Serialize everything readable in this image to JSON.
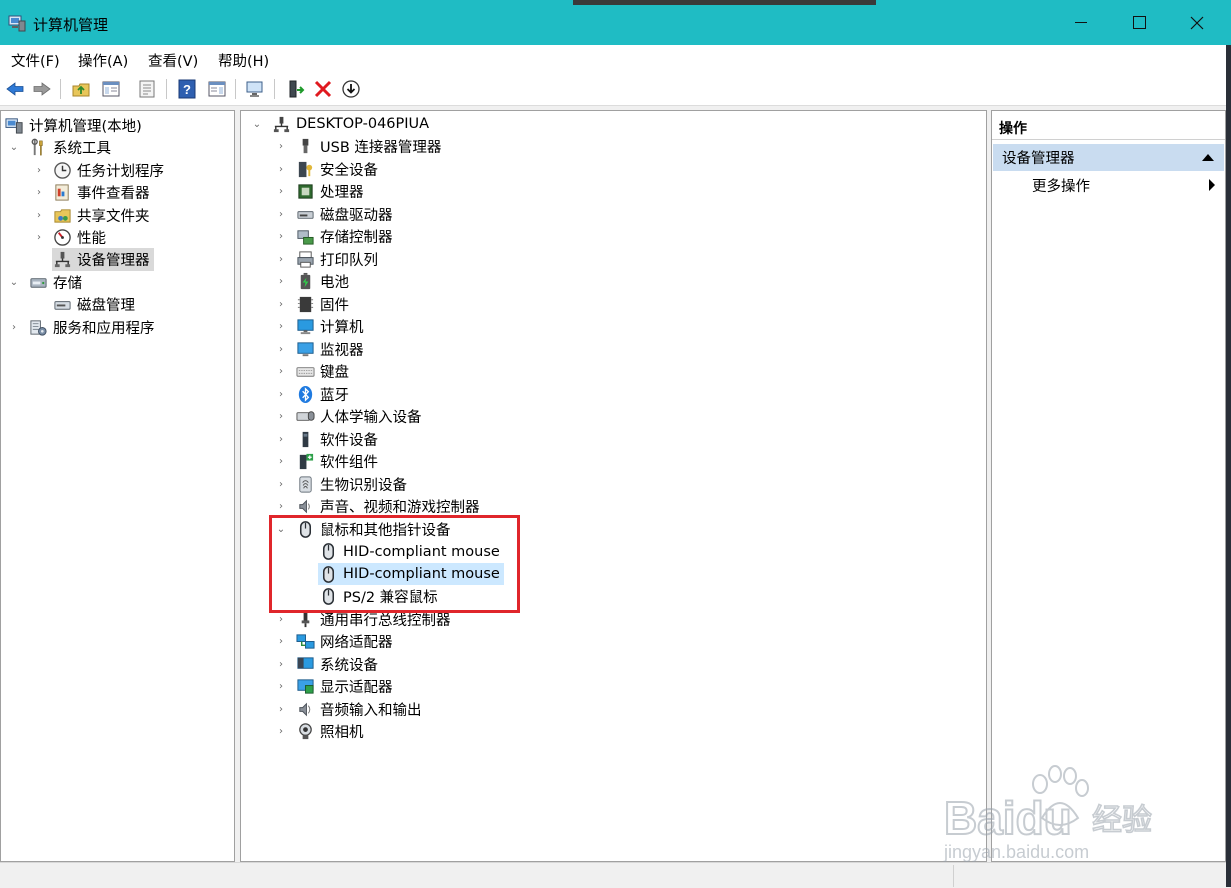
{
  "window": {
    "title": "计算机管理"
  },
  "menu": [
    "文件(F)",
    "操作(A)",
    "查看(V)",
    "帮助(H)"
  ],
  "toolbar": [
    "back-icon",
    "forward-icon",
    "up-folder-icon",
    "show-hide-tree-icon",
    "properties-icon",
    "help-icon",
    "show-hide-action-pane-icon",
    "scan-hardware-icon",
    "enable-device-icon",
    "uninstall-device-icon",
    "update-driver-icon"
  ],
  "left_tree": {
    "root": "计算机管理(本地)",
    "system_tools": "系统工具",
    "task_scheduler": "任务计划程序",
    "event_viewer": "事件查看器",
    "shared_folders": "共享文件夹",
    "performance": "性能",
    "device_manager": "设备管理器",
    "storage": "存储",
    "disk_management": "磁盘管理",
    "services_apps": "服务和应用程序"
  },
  "device_tree": {
    "root": "DESKTOP-046PIUA",
    "categories": [
      "USB 连接器管理器",
      "安全设备",
      "处理器",
      "磁盘驱动器",
      "存储控制器",
      "打印队列",
      "电池",
      "固件",
      "计算机",
      "监视器",
      "键盘",
      "蓝牙",
      "人体学输入设备",
      "软件设备",
      "软件组件",
      "生物识别设备",
      "声音、视频和游戏控制器",
      "鼠标和其他指针设备"
    ],
    "mouse_children": [
      "HID-compliant mouse",
      "HID-compliant mouse",
      "PS/2 兼容鼠标"
    ],
    "categories_after": [
      "通用串行总线控制器",
      "网络适配器",
      "系统设备",
      "显示适配器",
      "音频输入和输出",
      "照相机"
    ]
  },
  "actions": {
    "title": "操作",
    "section": "设备管理器",
    "more": "更多操作"
  },
  "watermark": {
    "brand": "Baidu",
    "cn": "经验",
    "url": "jingyan.baidu.com"
  },
  "colors": {
    "titlebar": "#1fbcc4",
    "highlight_box": "#e0262b",
    "selected": "#cce8ff"
  }
}
